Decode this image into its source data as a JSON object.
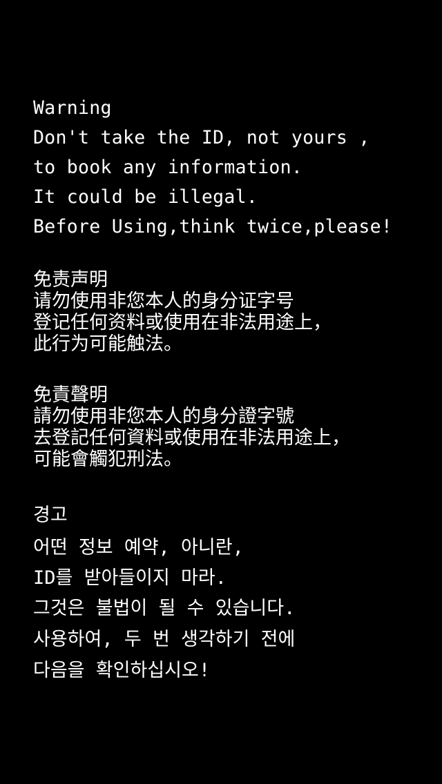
{
  "english": {
    "title": "Warning",
    "lines": [
      "Don't take the ID, not yours ,",
      "to book any information.",
      "It could be illegal.",
      "Before Using,think twice,please!"
    ]
  },
  "simplified_chinese": {
    "title": "免责声明",
    "lines": [
      "请勿使用非您本人的身分证字号",
      "登记任何资料或使用在非法用途上，",
      "此行为可能触法。"
    ]
  },
  "traditional_chinese": {
    "title": "免責聲明",
    "lines": [
      "請勿使用非您本人的身分證字號",
      "去登記任何資料或使用在非法用途上，",
      "可能會觸犯刑法。"
    ]
  },
  "korean": {
    "title": "경고",
    "lines": [
      "어떤 정보 예약, 아니란,",
      "ID를 받아들이지 마라.",
      "그것은 불법이 될 수 있습니다.",
      "사용하여, 두 번 생각하기 전에",
      "다음을 확인하십시오!"
    ]
  },
  "colors": {
    "background": "#000000",
    "text": "#ffffff"
  }
}
